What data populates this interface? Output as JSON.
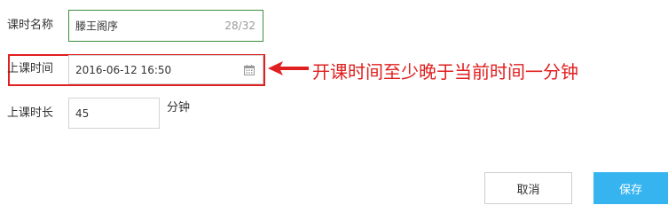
{
  "form": {
    "name": {
      "label": "课时名称",
      "value": "滕王阁序",
      "counter": "28/32"
    },
    "start_time": {
      "label": "上课时间",
      "value": "2016-06-12 16:50"
    },
    "duration": {
      "label": "上课时长",
      "value": "45",
      "unit": "分钟"
    }
  },
  "annotation": {
    "text": "开课时间至少晚于当前时间一分钟",
    "color": "#e02020"
  },
  "buttons": {
    "cancel": "取消",
    "save": "保存"
  },
  "colors": {
    "accent": "#36b4f0",
    "focus_border": "#3f8f3f",
    "annotation": "#e02020"
  },
  "icons": {
    "date_picker": "calendar-icon"
  }
}
